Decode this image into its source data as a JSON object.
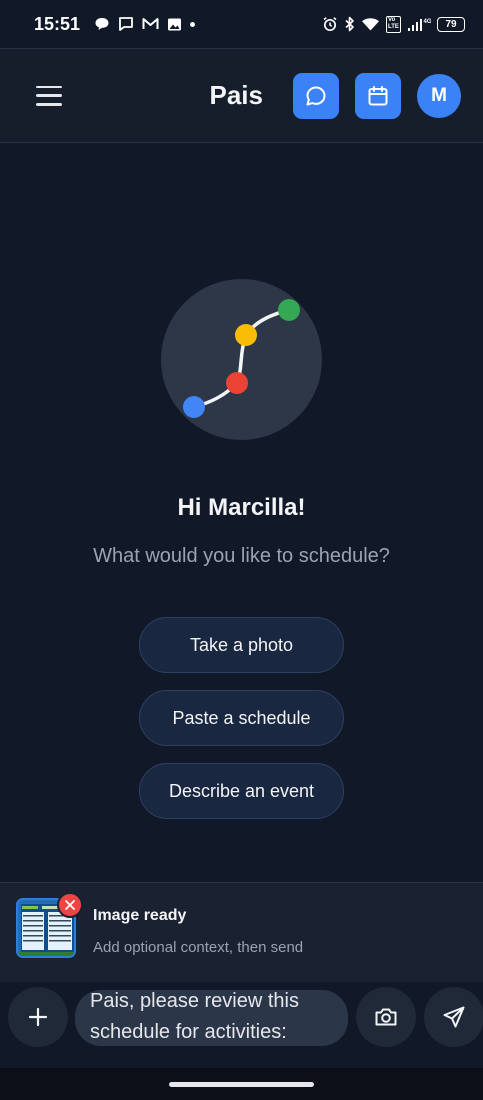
{
  "status_bar": {
    "time": "15:51",
    "left_icons": [
      "chat-bubble-icon",
      "message-icon",
      "gmail-icon",
      "image-icon",
      "dot-icon"
    ],
    "right_icons": [
      "alarm-icon",
      "bluetooth-icon",
      "wifi-icon",
      "volte-icon",
      "signal-icon"
    ],
    "network": "4G",
    "battery": "79"
  },
  "header": {
    "title": "Pais",
    "avatar_initial": "M",
    "accent": "#3b82f6"
  },
  "hero": {
    "greeting": "Hi Marcilla!",
    "subtitle": "What would you like to schedule?",
    "logo_dot_colors": [
      "#4285f4",
      "#ea4335",
      "#fbbc04",
      "#34a853"
    ]
  },
  "suggestions": [
    {
      "label": "Take a photo"
    },
    {
      "label": "Paste a schedule"
    },
    {
      "label": "Describe an event"
    }
  ],
  "attachment": {
    "title": "Image ready",
    "subtitle": "Add optional context, then send"
  },
  "composer": {
    "message_line1": "Pais, please review this",
    "message_line2": "schedule for activities:"
  }
}
